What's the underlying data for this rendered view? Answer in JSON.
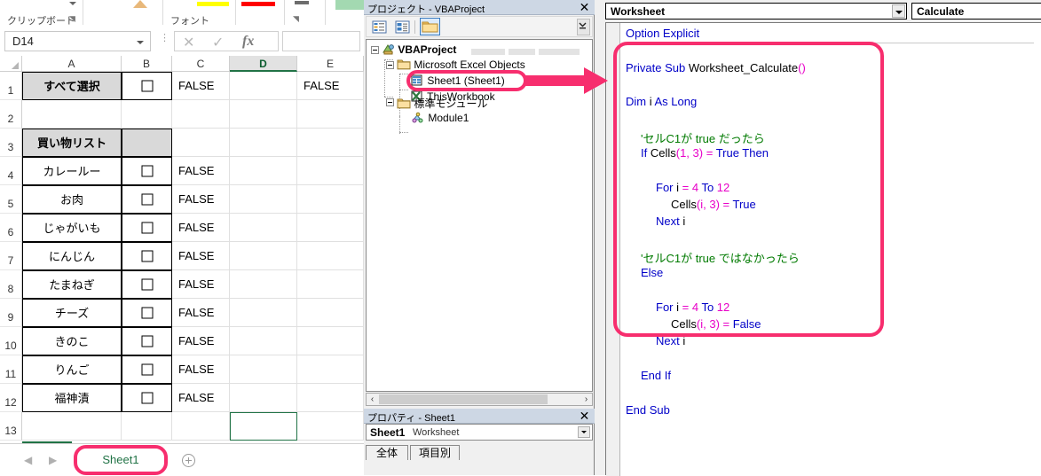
{
  "excel": {
    "ribbon": {
      "group_clipboard": "クリップボード",
      "group_font": "フォント",
      "dialog_launcher": "⌐",
      "swatch_yellow": "#ffff00",
      "swatch_red": "#ff0000",
      "swatch_green": "#a3d9b1"
    },
    "formula_bar": {
      "name_box_value": "D14",
      "cancel_icon": "✕",
      "enter_icon": "✓",
      "function_icon": "fx",
      "formula_value": ""
    },
    "columns": [
      "A",
      "B",
      "C",
      "D",
      "E"
    ],
    "active_column": "D",
    "row_numbers": [
      "1",
      "2",
      "3",
      "4",
      "5",
      "6",
      "7",
      "8",
      "9",
      "10",
      "11",
      "12",
      "13"
    ],
    "rows": [
      {
        "n": "1",
        "a": "すべて選択",
        "a_style": "header",
        "b": "checkbox",
        "c": "FALSE",
        "d": "",
        "e": "FALSE"
      },
      {
        "n": "2",
        "a": "",
        "a_style": "plain",
        "b": "",
        "c": "",
        "d": "",
        "e": ""
      },
      {
        "n": "3",
        "a": "買い物リスト",
        "a_style": "header",
        "b": "fill",
        "c": "",
        "d": "",
        "e": ""
      },
      {
        "n": "4",
        "a": "カレールー",
        "a_style": "item",
        "b": "checkbox",
        "c": "FALSE",
        "d": "",
        "e": ""
      },
      {
        "n": "5",
        "a": "お肉",
        "a_style": "item",
        "b": "checkbox",
        "c": "FALSE",
        "d": "",
        "e": ""
      },
      {
        "n": "6",
        "a": "じゃがいも",
        "a_style": "item",
        "b": "checkbox",
        "c": "FALSE",
        "d": "",
        "e": ""
      },
      {
        "n": "7",
        "a": "にんじん",
        "a_style": "item",
        "b": "checkbox",
        "c": "FALSE",
        "d": "",
        "e": ""
      },
      {
        "n": "8",
        "a": "たまねぎ",
        "a_style": "item",
        "b": "checkbox",
        "c": "FALSE",
        "d": "",
        "e": ""
      },
      {
        "n": "9",
        "a": "チーズ",
        "a_style": "item",
        "b": "checkbox",
        "c": "FALSE",
        "d": "",
        "e": ""
      },
      {
        "n": "10",
        "a": "きのこ",
        "a_style": "item",
        "b": "checkbox",
        "c": "FALSE",
        "d": "",
        "e": ""
      },
      {
        "n": "11",
        "a": "りんご",
        "a_style": "item",
        "b": "checkbox",
        "c": "FALSE",
        "d": "",
        "e": ""
      },
      {
        "n": "12",
        "a": "福神漬",
        "a_style": "item",
        "b": "checkbox",
        "c": "FALSE",
        "d": "",
        "e": ""
      },
      {
        "n": "13",
        "a": "",
        "a_style": "plain",
        "b": "",
        "c": "",
        "d": "",
        "e": ""
      }
    ],
    "sheet_tabs": {
      "prev_icon": "◀",
      "next_icon": "▶",
      "active_tab": "Sheet1",
      "add_sheet_icon": "+"
    }
  },
  "project_pane": {
    "title": "プロジェクト - VBAProject",
    "close_icon": "✕",
    "toolbar": {
      "view_code_icon": "view-code",
      "view_object_icon": "view-object",
      "toggle_folders_icon": "toggle-folders"
    },
    "tree": [
      {
        "label": "VBAProject",
        "level": 0,
        "bold": true,
        "icon": "project-icon"
      },
      {
        "label": "Microsoft Excel Objects",
        "level": 1,
        "bold": false,
        "icon": "folder-icon"
      },
      {
        "label": "Sheet1 (Sheet1)",
        "level": 2,
        "bold": false,
        "icon": "sheet-icon"
      },
      {
        "label": "ThisWorkbook",
        "level": 2,
        "bold": false,
        "icon": "workbook-icon"
      },
      {
        "label": "標準モジュール",
        "level": 1,
        "bold": false,
        "icon": "folder-icon"
      },
      {
        "label": "Module1",
        "level": 2,
        "bold": false,
        "icon": "module-icon"
      }
    ],
    "scroll_left_icon": "‹",
    "scroll_right_icon": "›"
  },
  "properties_pane": {
    "title": "プロパティ - Sheet1",
    "close_icon": "✕",
    "object_name": "Sheet1",
    "object_type": "Worksheet",
    "tabs": [
      {
        "label": "全体",
        "active": true
      },
      {
        "label": "項目別",
        "active": false
      }
    ]
  },
  "code_pane": {
    "object_dropdown": "Worksheet",
    "procedure_dropdown": "Calculate",
    "lines": [
      {
        "indent": 0,
        "tokens": [
          {
            "t": "Option Explicit",
            "c": "kw"
          }
        ]
      },
      {
        "indent": 0,
        "tokens": []
      },
      {
        "indent": 0,
        "tokens": [
          {
            "t": "Private Sub ",
            "c": "kw"
          },
          {
            "t": "Worksheet_Calculate",
            "c": "pl"
          },
          {
            "t": "()",
            "c": "num"
          }
        ]
      },
      {
        "indent": 0,
        "tokens": []
      },
      {
        "indent": 0,
        "tokens": [
          {
            "t": "Dim ",
            "c": "kw"
          },
          {
            "t": "i ",
            "c": "pl"
          },
          {
            "t": "As Long",
            "c": "kw"
          }
        ]
      },
      {
        "indent": 0,
        "tokens": []
      },
      {
        "indent": 1,
        "tokens": [
          {
            "t": "'セルC1が true だったら",
            "c": "cm"
          }
        ]
      },
      {
        "indent": 1,
        "tokens": [
          {
            "t": "If ",
            "c": "kw"
          },
          {
            "t": "Cells",
            "c": "pl"
          },
          {
            "t": "(1, 3)",
            "c": "num"
          },
          {
            "t": " = ",
            "c": "num"
          },
          {
            "t": "True Then",
            "c": "kw"
          }
        ]
      },
      {
        "indent": 1,
        "tokens": []
      },
      {
        "indent": 2,
        "tokens": [
          {
            "t": "For ",
            "c": "kw"
          },
          {
            "t": "i ",
            "c": "pl"
          },
          {
            "t": "= ",
            "c": "num"
          },
          {
            "t": "4 ",
            "c": "num"
          },
          {
            "t": "To ",
            "c": "kw"
          },
          {
            "t": "12",
            "c": "num"
          }
        ]
      },
      {
        "indent": 3,
        "tokens": [
          {
            "t": "Cells",
            "c": "pl"
          },
          {
            "t": "(i, 3)",
            "c": "num"
          },
          {
            "t": " = ",
            "c": "num"
          },
          {
            "t": "True",
            "c": "kw"
          }
        ]
      },
      {
        "indent": 2,
        "tokens": [
          {
            "t": "Next ",
            "c": "kw"
          },
          {
            "t": "i",
            "c": "pl"
          }
        ]
      },
      {
        "indent": 0,
        "tokens": []
      },
      {
        "indent": 1,
        "tokens": [
          {
            "t": "'セルC1が true ではなかったら",
            "c": "cm"
          }
        ]
      },
      {
        "indent": 1,
        "tokens": [
          {
            "t": "Else",
            "c": "kw"
          }
        ]
      },
      {
        "indent": 1,
        "tokens": []
      },
      {
        "indent": 2,
        "tokens": [
          {
            "t": "For ",
            "c": "kw"
          },
          {
            "t": "i ",
            "c": "pl"
          },
          {
            "t": "= ",
            "c": "num"
          },
          {
            "t": "4 ",
            "c": "num"
          },
          {
            "t": "To ",
            "c": "kw"
          },
          {
            "t": "12",
            "c": "num"
          }
        ]
      },
      {
        "indent": 3,
        "tokens": [
          {
            "t": "Cells",
            "c": "pl"
          },
          {
            "t": "(i, 3)",
            "c": "num"
          },
          {
            "t": " = ",
            "c": "num"
          },
          {
            "t": "False",
            "c": "kw"
          }
        ]
      },
      {
        "indent": 2,
        "tokens": [
          {
            "t": "Next ",
            "c": "kw"
          },
          {
            "t": "i",
            "c": "pl"
          }
        ]
      },
      {
        "indent": 0,
        "tokens": []
      },
      {
        "indent": 1,
        "tokens": [
          {
            "t": "End If",
            "c": "kw"
          }
        ]
      },
      {
        "indent": 0,
        "tokens": []
      },
      {
        "indent": 0,
        "tokens": [
          {
            "t": "End Sub",
            "c": "kw"
          }
        ]
      }
    ]
  },
  "annotations": {
    "accent_color": "#f72e6e",
    "highlight_sheet_node": "Sheet1 (Sheet1)",
    "highlight_code_block": "Worksheet_Calculate procedure",
    "highlight_sheet_tab": "Sheet1",
    "arrow": "points from Sheet1 node to code pane"
  }
}
